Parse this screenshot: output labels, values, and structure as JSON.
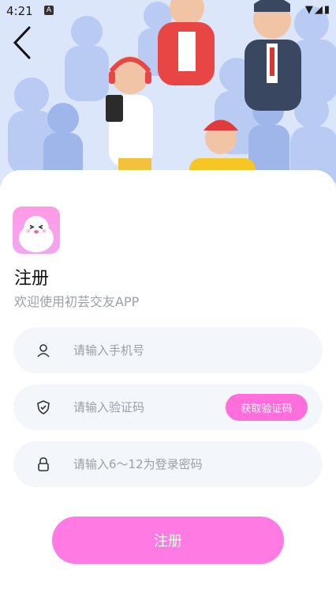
{
  "status_bar": {
    "time": "4:21",
    "badge": "A"
  },
  "header": {
    "back_icon": "chevron-left-icon"
  },
  "title": "注册",
  "subtitle": "欢迎使用初芸交友APP",
  "fields": {
    "phone": {
      "icon": "user-icon",
      "placeholder": "请输入手机号"
    },
    "code": {
      "icon": "shield-icon",
      "placeholder": "请输入验证码",
      "button_label": "获取验证码"
    },
    "password": {
      "icon": "lock-icon",
      "placeholder": "请输入6～12为登录密码"
    }
  },
  "submit_label": "注册",
  "colors": {
    "accent": "#ff7ae2",
    "field_bg": "#f3f6fa",
    "hero_bg": "#dbe6fb"
  }
}
